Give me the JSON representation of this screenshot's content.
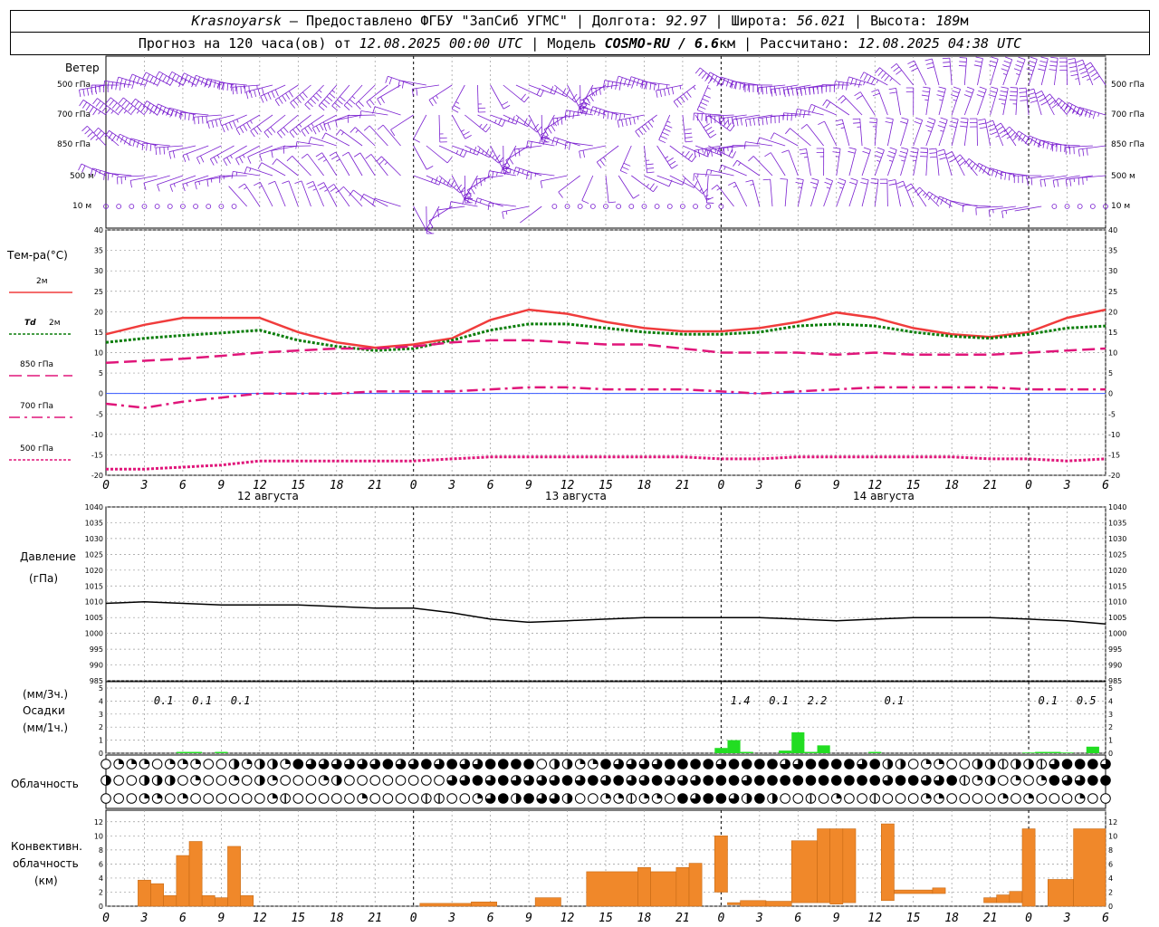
{
  "header": {
    "station": "Krasnoyarsk",
    "provider": "— Предоставлено ФГБУ \"ЗапСиб УГМС\"",
    "lon_label": "Долгота:",
    "lon": "92.97",
    "lat_label": "Широта:",
    "lat": "56.021",
    "alt_label": "Высота:",
    "alt": "189",
    "alt_unit": "м"
  },
  "subheader": {
    "forecast_label": "Прогноз на 120 часа(ов) от",
    "start": "12.08.2025 00:00 UTC",
    "model_label": "Модель",
    "model": "COSMO-RU / 6.6",
    "model_unit": "км",
    "calc_label": "Рассчитано:",
    "calc_time": "12.08.2025 04:38 UTC"
  },
  "labels": {
    "wind": "Ветер",
    "wind_levels": [
      "500 гПа",
      "700 гПа",
      "850 гПа",
      "500 м",
      "10 м"
    ],
    "temp": "Тем-ра(°C)",
    "t2m": "2м",
    "td_a": "Td",
    "td_b": "2м",
    "t850": "850 гПа",
    "t700": "700 гПа",
    "t500": "500 гПа",
    "pressure": "Давление",
    "pressure_unit": "(гПа)",
    "prec_3h": "(мм/3ч.)",
    "prec": "Осадки",
    "prec_1h": "(мм/1ч.)",
    "cloud": "Облачность",
    "conv1": "Конвективн.",
    "conv2": "облачность",
    "conv3": "(км)",
    "days": [
      "12 августа",
      "13 августа",
      "14 августа"
    ]
  },
  "hour_ticks": [
    "0",
    "3",
    "6",
    "9",
    "12",
    "15",
    "18",
    "21",
    "0",
    "3",
    "6",
    "9",
    "12",
    "15",
    "18",
    "21",
    "0",
    "3",
    "6",
    "9",
    "12",
    "15",
    "18",
    "21",
    "0",
    "3",
    "6"
  ],
  "precip_3h_labels": [
    {
      "h": 4.5,
      "text": "0.1"
    },
    {
      "h": 7.5,
      "text": "0.1"
    },
    {
      "h": 10.5,
      "text": "0.1"
    },
    {
      "h": 49.5,
      "text": "1.4"
    },
    {
      "h": 52.5,
      "text": "0.1"
    },
    {
      "h": 55.5,
      "text": "2.2"
    },
    {
      "h": 61.5,
      "text": "0.1"
    },
    {
      "h": 73.5,
      "text": "0.1"
    },
    {
      "h": 76.5,
      "text": "0.5"
    }
  ],
  "colors": {
    "wind": "#7a1fd0",
    "t2m": "#f03c3c",
    "td2m": "#0a7d0a",
    "t850": "#e0167a",
    "t700": "#e0167a",
    "t500": "#e0167a",
    "pressure": "#000000",
    "precip": "#22dd22",
    "conv": "#f0882a",
    "zero_line": "#3355ff"
  },
  "chart_data": [
    {
      "type": "line",
      "title": "Тем-ра(°C)",
      "x_unit": "hours since 12.08.2025 00:00 UTC",
      "ylim": [
        -20,
        40
      ],
      "yticks": [
        -20,
        -15,
        -10,
        -5,
        0,
        5,
        10,
        15,
        20,
        25,
        30,
        35,
        40
      ],
      "x": [
        0,
        3,
        6,
        9,
        12,
        15,
        18,
        21,
        24,
        27,
        30,
        33,
        36,
        39,
        42,
        45,
        48,
        51,
        54,
        57,
        60,
        63,
        66,
        69,
        72,
        75,
        78
      ],
      "series": [
        {
          "name": "2м",
          "style": "solid",
          "values": [
            14.5,
            16.8,
            18.5,
            18.5,
            18.5,
            15,
            12.5,
            11.2,
            12,
            13.5,
            18,
            20.5,
            19.5,
            17.5,
            16,
            15.2,
            15.2,
            16,
            17.5,
            19.8,
            18.5,
            16,
            14.5,
            13.8,
            15,
            18.5,
            20.5
          ]
        },
        {
          "name": "Td 2м",
          "style": "dotted",
          "values": [
            12.5,
            13.5,
            14.2,
            14.8,
            15.5,
            13,
            11.5,
            10.5,
            11,
            13,
            15.5,
            17,
            17,
            16,
            15,
            14.5,
            14.5,
            15,
            16.5,
            17,
            16.5,
            15,
            14,
            13.5,
            14.5,
            16,
            16.5
          ]
        },
        {
          "name": "850 гПа",
          "style": "dashed",
          "values": [
            7.5,
            8,
            8.5,
            9.2,
            10,
            10.5,
            11,
            11,
            11.5,
            12.5,
            13,
            13,
            12.5,
            12,
            12,
            11,
            10,
            10,
            10,
            9.5,
            10,
            9.5,
            9.5,
            9.5,
            10,
            10.5,
            11
          ]
        },
        {
          "name": "700 гПа",
          "style": "dashdot",
          "values": [
            -2.5,
            -3.5,
            -2,
            -1,
            0,
            0,
            0,
            0.5,
            0.5,
            0.5,
            1,
            1.5,
            1.5,
            1,
            1,
            1,
            0.5,
            0,
            0.5,
            1,
            1.5,
            1.5,
            1.5,
            1.5,
            1,
            1,
            1
          ]
        },
        {
          "name": "500 гПа",
          "style": "dotted",
          "values": [
            -18.5,
            -18.5,
            -18,
            -17.5,
            -16.5,
            -16.5,
            -16.5,
            -16.5,
            -16.5,
            -16,
            -15.5,
            -15.5,
            -15.5,
            -15.5,
            -15.5,
            -15.5,
            -16,
            -16,
            -15.5,
            -15.5,
            -15.5,
            -15.5,
            -15.5,
            -16,
            -16,
            -16.5,
            -16
          ]
        }
      ]
    },
    {
      "type": "line",
      "title": "Давление",
      "ylabel": "(гПа)",
      "ylim": [
        985,
        1040
      ],
      "yticks": [
        985,
        990,
        995,
        1000,
        1005,
        1010,
        1015,
        1020,
        1025,
        1030,
        1035,
        1040
      ],
      "x": [
        0,
        3,
        6,
        9,
        12,
        15,
        18,
        21,
        24,
        27,
        30,
        33,
        36,
        39,
        42,
        45,
        48,
        51,
        54,
        57,
        60,
        63,
        66,
        69,
        72,
        75,
        78
      ],
      "series": [
        {
          "name": "Давление",
          "values": [
            1009.5,
            1010,
            1009.5,
            1009,
            1009,
            1009,
            1008.5,
            1008,
            1008,
            1006.5,
            1004.5,
            1003.5,
            1004,
            1004.5,
            1005,
            1005,
            1005,
            1005,
            1004.5,
            1004,
            1004.5,
            1005,
            1005,
            1005,
            1004.5,
            1004,
            1003
          ]
        }
      ]
    },
    {
      "type": "bar",
      "title": "Осадки",
      "ylabel": "(мм/1ч.)",
      "ylim": [
        0,
        5
      ],
      "yticks": [
        0,
        1,
        2,
        3,
        4,
        5
      ],
      "x": [
        6,
        7,
        9,
        48,
        49,
        50,
        53,
        54,
        55,
        56,
        60,
        72,
        73,
        74,
        75,
        77
      ],
      "values": [
        0.1,
        0.1,
        0.1,
        0.4,
        1,
        0.1,
        0.2,
        1.6,
        0.1,
        0.6,
        0.1,
        0.05,
        0.1,
        0.1,
        0.05,
        0.5
      ]
    },
    {
      "type": "bar",
      "title": "Конвективн. облачность",
      "ylabel": "(км)",
      "ylim": [
        0,
        13
      ],
      "yticks": [
        0,
        2,
        4,
        6,
        8,
        10,
        12
      ],
      "bars": [
        {
          "x0": 2.5,
          "x1": 3.5,
          "bottom": 0,
          "top": 3.7
        },
        {
          "x0": 3.5,
          "x1": 4.5,
          "bottom": 0,
          "top": 3.2
        },
        {
          "x0": 4.5,
          "x1": 5.5,
          "bottom": 0,
          "top": 1.5
        },
        {
          "x0": 5.5,
          "x1": 6.5,
          "bottom": 0,
          "top": 7.2
        },
        {
          "x0": 6.5,
          "x1": 7.5,
          "bottom": 0,
          "top": 9.2
        },
        {
          "x0": 7.5,
          "x1": 8.5,
          "bottom": 0,
          "top": 1.5
        },
        {
          "x0": 8.5,
          "x1": 9.5,
          "bottom": 0,
          "top": 1.2
        },
        {
          "x0": 9.5,
          "x1": 10.5,
          "bottom": 0,
          "top": 8.5
        },
        {
          "x0": 10.5,
          "x1": 11.5,
          "bottom": 0,
          "top": 1.5
        },
        {
          "x0": 24.5,
          "x1": 28.5,
          "bottom": 0,
          "top": 0.4
        },
        {
          "x0": 28.5,
          "x1": 30.5,
          "bottom": 0,
          "top": 0.6
        },
        {
          "x0": 33.5,
          "x1": 35.5,
          "bottom": 0,
          "top": 1.2
        },
        {
          "x0": 37.5,
          "x1": 41.5,
          "bottom": 0,
          "top": 4.9
        },
        {
          "x0": 41.5,
          "x1": 42.5,
          "bottom": 0,
          "top": 5.5
        },
        {
          "x0": 42.5,
          "x1": 44.5,
          "bottom": 0,
          "top": 4.9
        },
        {
          "x0": 44.5,
          "x1": 45.5,
          "bottom": 0,
          "top": 5.5
        },
        {
          "x0": 45.5,
          "x1": 46.5,
          "bottom": 0,
          "top": 6.1
        },
        {
          "x0": 47.5,
          "x1": 48.5,
          "bottom": 2,
          "top": 10
        },
        {
          "x0": 48.5,
          "x1": 49.5,
          "bottom": 0.2,
          "top": 0.5
        },
        {
          "x0": 49.5,
          "x1": 51.5,
          "bottom": 0,
          "top": 0.8
        },
        {
          "x0": 51.5,
          "x1": 53.5,
          "bottom": 0,
          "top": 0.7
        },
        {
          "x0": 53.5,
          "x1": 55.5,
          "bottom": 0.5,
          "top": 9.3
        },
        {
          "x0": 55.5,
          "x1": 56.5,
          "bottom": 0.5,
          "top": 11
        },
        {
          "x0": 56.5,
          "x1": 57.5,
          "bottom": 0.3,
          "top": 11
        },
        {
          "x0": 57.5,
          "x1": 58.5,
          "bottom": 0.5,
          "top": 11
        },
        {
          "x0": 60.5,
          "x1": 61.5,
          "bottom": 0.8,
          "top": 11.7
        },
        {
          "x0": 61.5,
          "x1": 64.5,
          "bottom": 1.8,
          "top": 2.3
        },
        {
          "x0": 64.5,
          "x1": 65.5,
          "bottom": 1.8,
          "top": 2.6
        },
        {
          "x0": 68.5,
          "x1": 69.5,
          "bottom": 0.5,
          "top": 1.2
        },
        {
          "x0": 69.5,
          "x1": 70.5,
          "bottom": 0.5,
          "top": 1.6
        },
        {
          "x0": 70.5,
          "x1": 71.5,
          "bottom": 0.5,
          "top": 2.1
        },
        {
          "x0": 71.5,
          "x1": 72.5,
          "bottom": 0,
          "top": 11
        },
        {
          "x0": 73.5,
          "x1": 75.5,
          "bottom": 0,
          "top": 3.8
        },
        {
          "x0": 75.5,
          "x1": 78,
          "bottom": 0,
          "top": 11
        }
      ]
    }
  ]
}
